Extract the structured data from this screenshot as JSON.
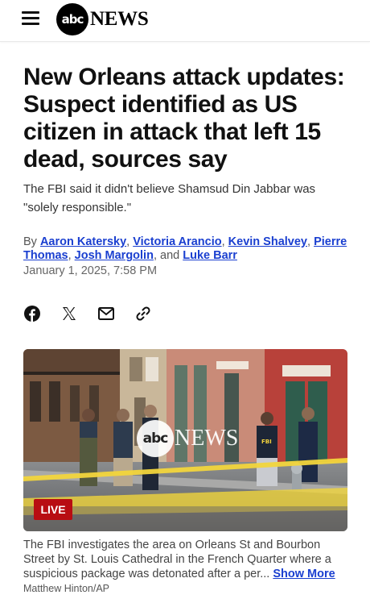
{
  "header": {
    "menu_icon": "hamburger-menu-icon",
    "logo_circle_text": "abc",
    "logo_news_text": "NEWS"
  },
  "article": {
    "headline": "New Orleans attack updates: Suspect identified as US citizen in attack that left 15 dead, sources say",
    "dek": "The FBI said it didn't believe Shamsud Din Jabbar was \"solely responsible.\"",
    "byline_prefix": "By",
    "authors": [
      "Aaron Katersky",
      "Victoria Arancio",
      "Kevin Shalvey",
      "Pierre Thomas",
      "Josh Margolin",
      "Luke Barr"
    ],
    "byline_sep": ", ",
    "byline_and": ", and ",
    "date": "January 1, 2025, 7:58 PM"
  },
  "share": {
    "icons": [
      "facebook-icon",
      "x-icon",
      "email-icon",
      "link-icon"
    ]
  },
  "media": {
    "live_label": "LIVE",
    "watermark_circle": "abc",
    "watermark_news": "NEWS",
    "jacket_text": "FBI",
    "caption_text": "The FBI investigates the area on Orleans St and Bourbon Street by St. Louis Cathedral in the French Quarter where a suspicious package was detonated after a per...",
    "show_more_label": "Show More",
    "credit": "Matthew Hinton/AP"
  }
}
